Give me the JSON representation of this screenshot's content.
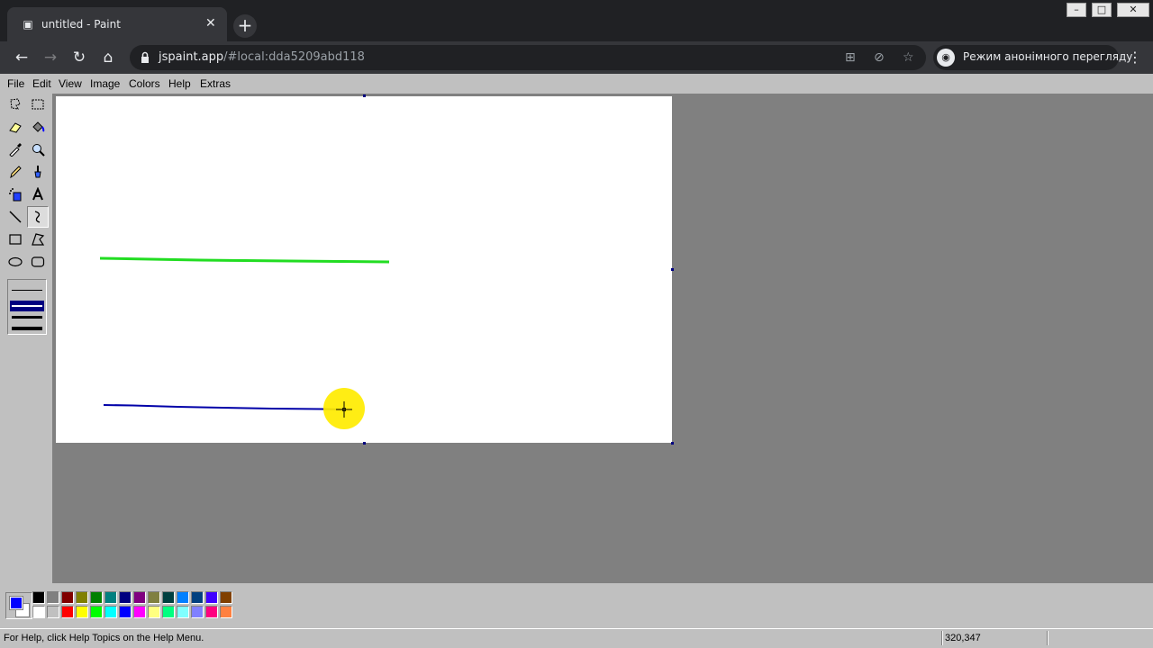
{
  "browser": {
    "tab_title": "untitled - Paint",
    "url_host": "jspaint.app",
    "url_path": "/#local:dda5209abd118",
    "incognito_label": "Режим анонімного перегляду",
    "icons": [
      "paint-favicon-icon",
      "close-tab-icon",
      "new-tab-icon",
      "back-icon",
      "forward-icon",
      "reload-icon",
      "home-icon",
      "lock-icon",
      "translate-icon",
      "eye-off-icon",
      "star-icon",
      "incognito-icon",
      "more-menu-icon",
      "minimize-icon",
      "maximize-icon",
      "close-window-icon"
    ]
  },
  "menu": {
    "items": [
      "File",
      "Edit",
      "View",
      "Image",
      "Colors",
      "Help",
      "Extras"
    ]
  },
  "tools": {
    "items": [
      "free-form-select",
      "select",
      "eraser",
      "fill-with-color",
      "pick-color",
      "magnifier",
      "pencil",
      "brush",
      "airbrush",
      "text",
      "line",
      "curve",
      "rectangle",
      "polygon",
      "ellipse",
      "rounded-rectangle"
    ],
    "selected": "curve",
    "stroke_widths": [
      1,
      2,
      3,
      4
    ],
    "selected_stroke": 2
  },
  "canvas": {
    "background": "#ffffff",
    "lines": [
      {
        "color": "#22dd22",
        "description": "green line"
      },
      {
        "color": "#0000a8",
        "description": "blue line"
      }
    ],
    "cursor_highlight_color": "#ffec00"
  },
  "palette": {
    "foreground": "#0000ff",
    "background": "#ffffff",
    "top_row": [
      "#000000",
      "#808080",
      "#800000",
      "#808000",
      "#008000",
      "#008080",
      "#000080",
      "#800080",
      "#808040",
      "#004040",
      "#0080ff",
      "#004080",
      "#4000ff",
      "#804000"
    ],
    "bottom_row": [
      "#ffffff",
      "#c0c0c0",
      "#ff0000",
      "#ffff00",
      "#00ff00",
      "#00ffff",
      "#0000ff",
      "#ff00ff",
      "#ffff80",
      "#00ff80",
      "#80ffff",
      "#8080ff",
      "#ff0080",
      "#ff8040"
    ]
  },
  "status": {
    "help_text": "For Help, click Help Topics on the Help Menu.",
    "coords": "320,347"
  }
}
